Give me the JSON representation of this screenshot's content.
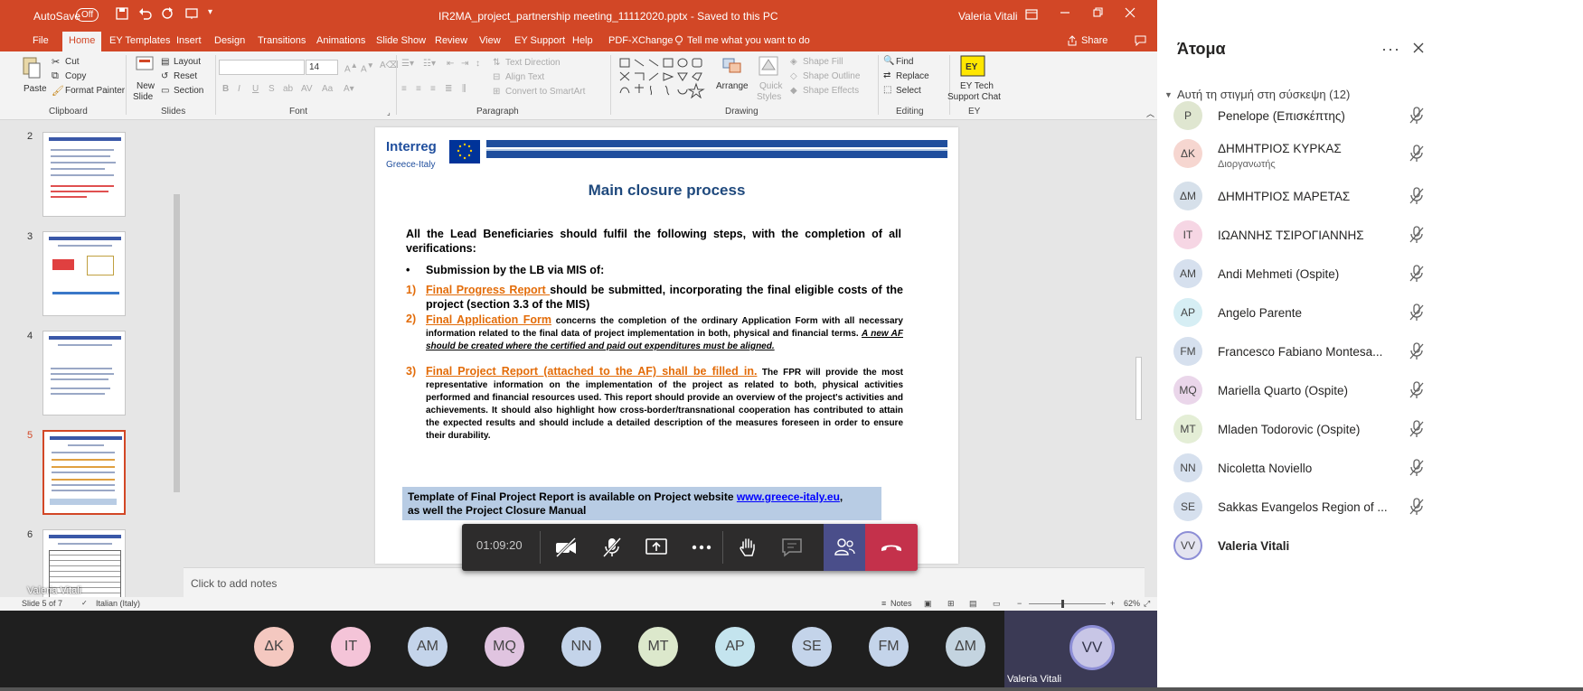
{
  "window": {
    "autosave_label": "AutoSave",
    "autosave_state": "Off",
    "file_title": "IR2MA_project_partnership meeting_11112020.pptx - Saved to this PC",
    "user_name": "Valeria Vitali"
  },
  "menu": {
    "tabs": [
      "File",
      "Home",
      "EY Templates",
      "Insert",
      "Design",
      "Transitions",
      "Animations",
      "Slide Show",
      "Review",
      "View",
      "EY Support",
      "Help",
      "PDF-XChange"
    ],
    "tell_me": "Tell me what you want to do",
    "share": "Share"
  },
  "ribbon": {
    "clipboard": {
      "paste": "Paste",
      "cut": "Cut",
      "copy": "Copy",
      "format_painter": "Format Painter",
      "group": "Clipboard"
    },
    "slides": {
      "new_slide_1": "New",
      "new_slide_2": "Slide",
      "layout": "Layout",
      "reset": "Reset",
      "section": "Section",
      "group": "Slides"
    },
    "font": {
      "size": "14",
      "group": "Font",
      "bold": "B",
      "italic": "I",
      "underline": "U",
      "strike": "S",
      "shadow": "ab",
      "spacing": "AV",
      "case": "Aa"
    },
    "paragraph": {
      "text_direction": "Text Direction",
      "align_text": "Align Text",
      "convert_smartart": "Convert to SmartArt",
      "group": "Paragraph"
    },
    "drawing": {
      "arrange": "Arrange",
      "quick_styles_1": "Quick",
      "quick_styles_2": "Styles",
      "shape_fill": "Shape Fill",
      "shape_outline": "Shape Outline",
      "shape_effects": "Shape Effects",
      "group": "Drawing"
    },
    "editing": {
      "find": "Find",
      "replace": "Replace",
      "select": "Select",
      "group": "Editing"
    },
    "ey": {
      "label_1": "EY Tech",
      "label_2": "Support Chat",
      "group": "EY"
    }
  },
  "thumbnails": [
    {
      "num": "2",
      "selected": false
    },
    {
      "num": "3",
      "selected": false
    },
    {
      "num": "4",
      "selected": false
    },
    {
      "num": "5",
      "selected": true
    },
    {
      "num": "6",
      "selected": false
    }
  ],
  "slide": {
    "logo_name": "Interreg",
    "logo_sub": "Greece-Italy",
    "title": "Main closure process",
    "intro": "All the Lead Beneficiaries should fulfil the following steps, with the completion of all verifications:",
    "bullet_pre": "Submission ",
    "bullet_bold": "by the LB",
    "bullet_post": " via MIS of:",
    "item1_num": "1)",
    "item1_link": "Final Progress Report ",
    "item1_text": "should be submitted, incorporating the final eligible costs of the project (section 3.3 of the MIS)",
    "item2_num": "2)",
    "item2_link": "Final Application Form",
    "item2_text": " concerns the completion of the ordinary Application Form with all necessary information related to the final data of project implementation in both, physical and financial terms. ",
    "item2_italic": "A new AF should be created where the certified and paid out expenditures must be aligned.",
    "item3_num": "3)",
    "item3_link": "Final Project Report (attached to the AF) shall be filled in.",
    "item3_text": " The FPR will provide the most representative information on the implementation of the project as related to both, physical activities performed and financial resources used. This report should provide an overview of the project's activities and achievements. It should also highlight how cross-border/transnational cooperation has contributed to attain the expected results and should include a detailed description of the measures foreseen in order to ensure their durability.",
    "callout_text": "Template of Final Project Report is available on Project website ",
    "callout_link": "www.greece-italy.eu",
    "callout_text2": ",",
    "callout_line2": " as well the Project Closure Manual"
  },
  "notes": {
    "placeholder": "Click to add notes",
    "overlay_name": "Valeria Vitali"
  },
  "status": {
    "slide_count": "Slide 5 of 7",
    "language": "Italian (Italy)",
    "notes": "Notes",
    "zoom": "62%"
  },
  "controls": {
    "timer": "01:09:20"
  },
  "bottom_avatars": [
    {
      "initials": "ΔΚ",
      "color": "#f4c8c0"
    },
    {
      "initials": "IT",
      "color": "#f4c4d8"
    },
    {
      "initials": "AM",
      "color": "#c4d4ea"
    },
    {
      "initials": "MQ",
      "color": "#e0c4e0"
    },
    {
      "initials": "NN",
      "color": "#c4d4ea"
    },
    {
      "initials": "MT",
      "color": "#dce8cc"
    },
    {
      "initials": "AP",
      "color": "#c4e4ee"
    },
    {
      "initials": "SE",
      "color": "#c4d4ea"
    },
    {
      "initials": "FM",
      "color": "#c4d4ea"
    },
    {
      "initials": "ΔΜ",
      "color": "#c4d4e0"
    }
  ],
  "self": {
    "initials": "VV",
    "name": "Valeria Vitali"
  },
  "people": {
    "title": "Άτομα",
    "section": "Αυτή τη στιγμή στη σύσκεψη (12)",
    "list": [
      {
        "initials": "P",
        "name": "Penelope (Επισκέπτης)",
        "sub": "",
        "color": "#dfe6d0"
      },
      {
        "initials": "ΔΚ",
        "name": "ΔΗΜΗΤΡΙΟΣ ΚΥΡΚΑΣ",
        "sub": "Διοργανωτής",
        "color": "#f6d6d0"
      },
      {
        "initials": "ΔΜ",
        "name": "ΔΗΜΗΤΡΙΟΣ ΜΑΡΕΤΑΣ",
        "sub": "",
        "color": "#d6e0ea"
      },
      {
        "initials": "IT",
        "name": "ΙΩΑΝΝΗΣ ΤΣΙΡΟΓΙΑΝΝΗΣ",
        "sub": "",
        "color": "#f6d6e4"
      },
      {
        "initials": "AM",
        "name": "Andi Mehmeti (Ospite)",
        "sub": "",
        "color": "#d6e0ee"
      },
      {
        "initials": "AP",
        "name": "Angelo Parente",
        "sub": "",
        "color": "#d6eef4"
      },
      {
        "initials": "FM",
        "name": "Francesco Fabiano Montesa...",
        "sub": "",
        "color": "#d6e0ee"
      },
      {
        "initials": "MQ",
        "name": "Mariella Quarto (Ospite)",
        "sub": "",
        "color": "#ead6ea"
      },
      {
        "initials": "MT",
        "name": "Mladen Todorovic (Ospite)",
        "sub": "",
        "color": "#e4eed6"
      },
      {
        "initials": "NN",
        "name": "Nicoletta Noviello",
        "sub": "",
        "color": "#d6e0ee"
      },
      {
        "initials": "SE",
        "name": "Sakkas Evangelos Region of ...",
        "sub": "",
        "color": "#d6e0ee"
      },
      {
        "initials": "VV",
        "name": "Valeria Vitali",
        "sub": "",
        "color": "#e4e4f0"
      }
    ]
  }
}
